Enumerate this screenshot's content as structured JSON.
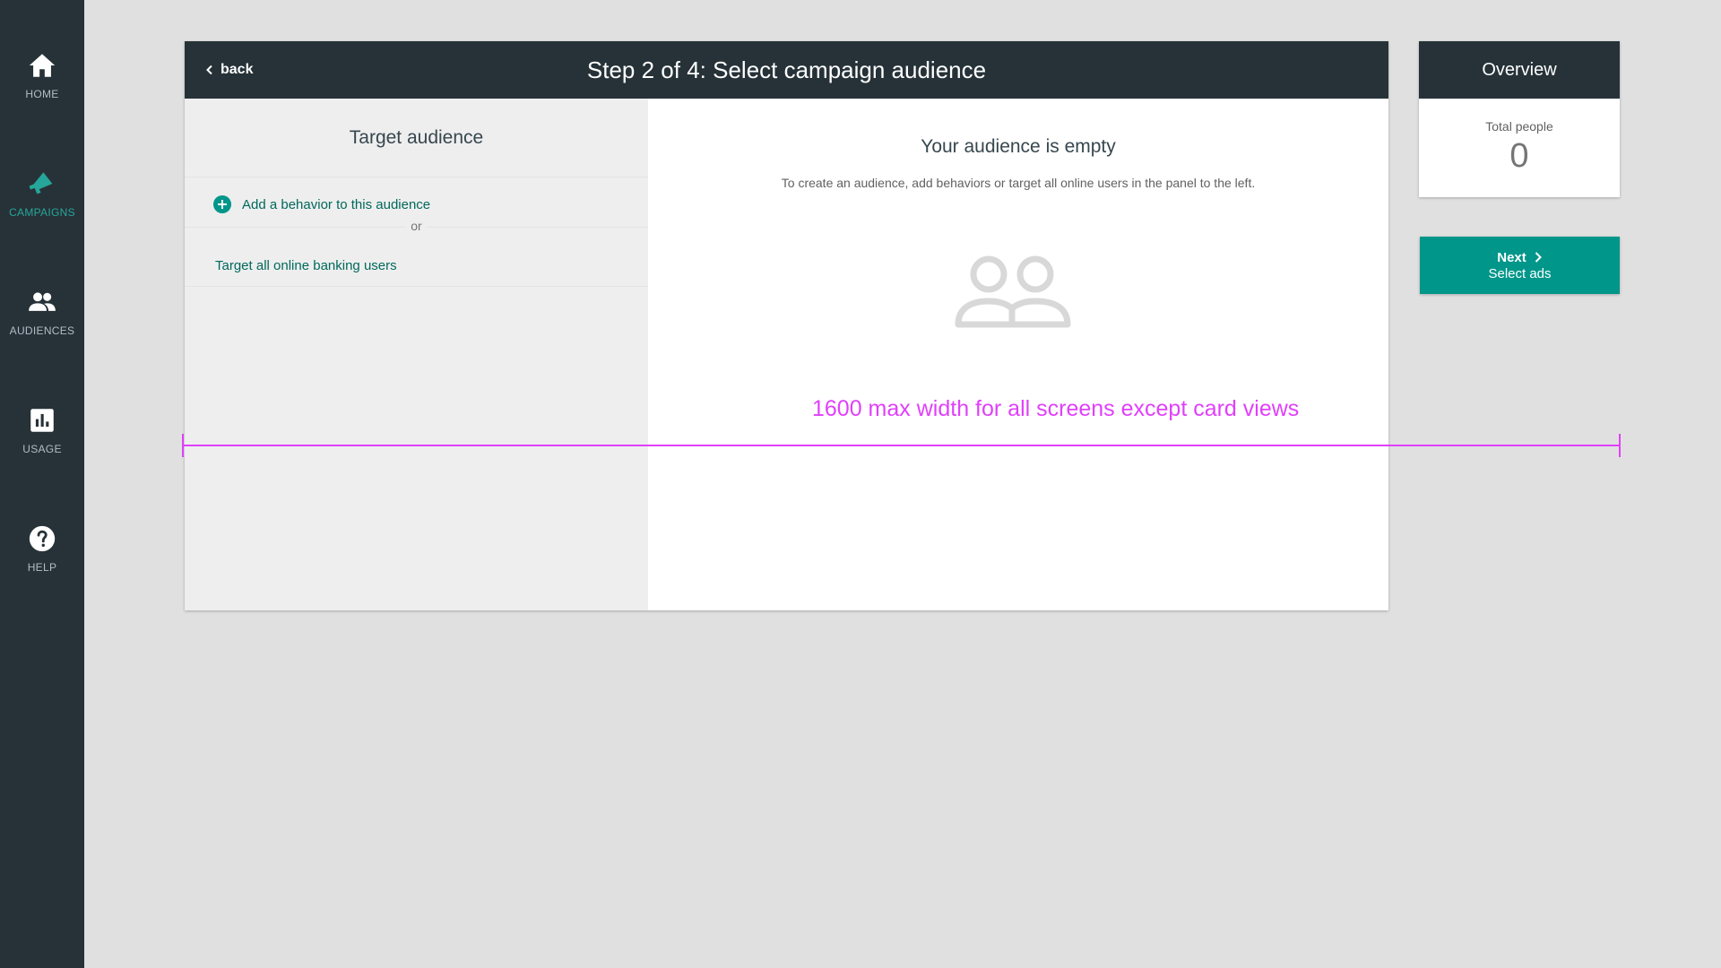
{
  "nav": {
    "items": [
      {
        "label": "HOME",
        "icon": "home-icon",
        "active": false
      },
      {
        "label": "CAMPAIGNS",
        "icon": "megaphone-icon",
        "active": true
      },
      {
        "label": "AUDIENCES",
        "icon": "people-icon",
        "active": false
      },
      {
        "label": "USAGE",
        "icon": "bar-chart-icon",
        "active": false
      },
      {
        "label": "HELP",
        "icon": "help-icon",
        "active": false
      }
    ]
  },
  "header": {
    "back_label": "back",
    "title": "Step 2 of 4: Select campaign audience"
  },
  "left_panel": {
    "title": "Target audience",
    "add_behavior_label": "Add a behavior to this audience",
    "or_label": "or",
    "target_all_label": "Target all online banking users"
  },
  "right_panel": {
    "empty_title": "Your audience is empty",
    "empty_description": "To create an audience, add behaviors or target all online users in the panel to the left."
  },
  "overview": {
    "title": "Overview",
    "total_label": "Total people",
    "total_value": "0"
  },
  "next_button": {
    "label": "Next",
    "sub_label": "Select ads"
  },
  "annotation": {
    "text": "1600 max width for all screens except card views"
  },
  "colors": {
    "sidebar_bg": "#263238",
    "accent": "#00968a",
    "link": "#00695c",
    "annotation": "#e040fb",
    "page_bg": "#e0e0e0"
  }
}
